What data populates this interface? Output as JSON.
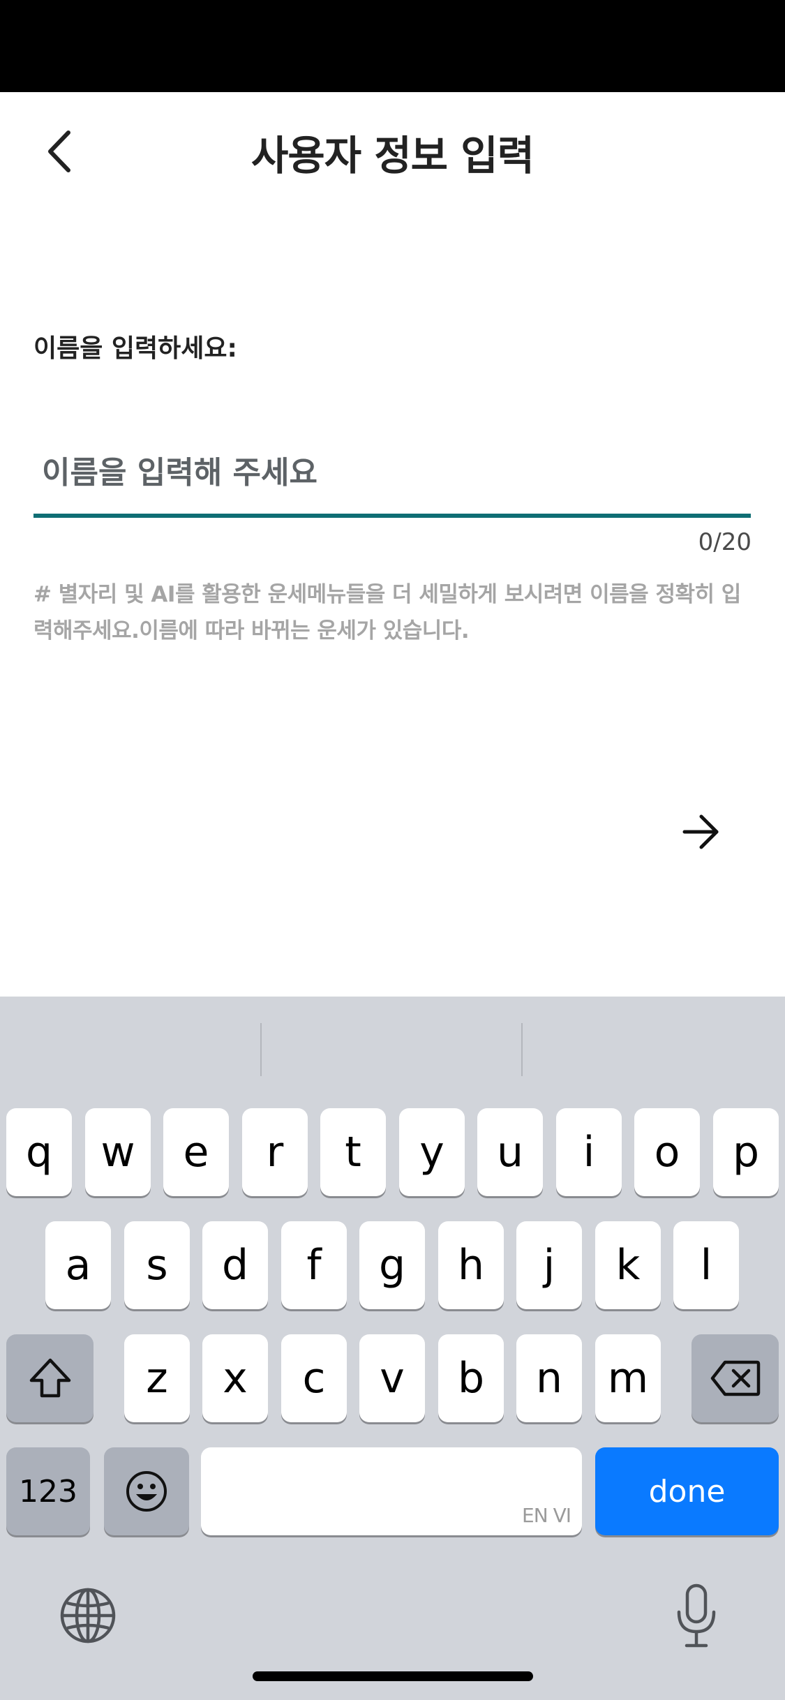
{
  "header": {
    "title": "사용자 정보 입력",
    "back_icon": "chevron-left-icon"
  },
  "form": {
    "label": "이름을 입력하세요:",
    "name_input": {
      "value": "",
      "placeholder": "이름을 입력해 주세요"
    },
    "counter": "0/20",
    "hint": "# 별자리 및 AI를 활용한 운세메뉴들을 더 세밀하게 보시려면 이름을 정확히 입력해주세요.이름에 따라 바뀌는 운세가 있습니다."
  },
  "next_icon": "arrow-right-icon",
  "keyboard": {
    "row1": [
      "q",
      "w",
      "e",
      "r",
      "t",
      "y",
      "u",
      "i",
      "o",
      "p"
    ],
    "row2": [
      "a",
      "s",
      "d",
      "f",
      "g",
      "h",
      "j",
      "k",
      "l"
    ],
    "row3": [
      "z",
      "x",
      "c",
      "v",
      "b",
      "n",
      "m"
    ],
    "numbers_label": "123",
    "space_language": "EN VI",
    "done_label": "done",
    "accent_color": "#0a7aff"
  },
  "colors": {
    "input_underline": "#0f6e74",
    "hint_text": "#a5a5a5"
  }
}
